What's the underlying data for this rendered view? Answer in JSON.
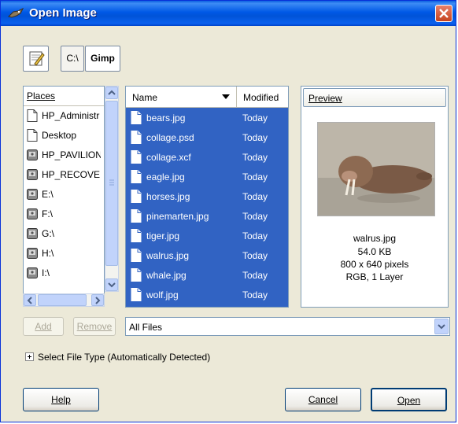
{
  "window": {
    "title": "Open Image"
  },
  "toolbar": {
    "path": [
      "C:\\",
      "Gimp"
    ]
  },
  "places": {
    "header": "Places",
    "items": [
      {
        "label": "HP_Administr",
        "icon": "document-icon"
      },
      {
        "label": "Desktop",
        "icon": "document-icon"
      },
      {
        "label": "HP_PAVILION",
        "icon": "drive-icon"
      },
      {
        "label": "HP_RECOVEI",
        "icon": "drive-icon"
      },
      {
        "label": "E:\\",
        "icon": "drive-icon"
      },
      {
        "label": "F:\\",
        "icon": "drive-icon"
      },
      {
        "label": "G:\\",
        "icon": "drive-icon"
      },
      {
        "label": "H:\\",
        "icon": "drive-icon"
      },
      {
        "label": "I:\\",
        "icon": "drive-icon"
      }
    ]
  },
  "files": {
    "columns": {
      "name": "Name",
      "modified": "Modified"
    },
    "rows": [
      {
        "name": "bears.jpg",
        "modified": "Today"
      },
      {
        "name": "collage.psd",
        "modified": "Today"
      },
      {
        "name": "collage.xcf",
        "modified": "Today"
      },
      {
        "name": "eagle.jpg",
        "modified": "Today"
      },
      {
        "name": "horses.jpg",
        "modified": "Today"
      },
      {
        "name": "pinemarten.jpg",
        "modified": "Today"
      },
      {
        "name": "tiger.jpg",
        "modified": "Today"
      },
      {
        "name": "walrus.jpg",
        "modified": "Today"
      },
      {
        "name": "whale.jpg",
        "modified": "Today"
      },
      {
        "name": "wolf.jpg",
        "modified": "Today"
      }
    ],
    "selection_color": "#3163c3"
  },
  "preview": {
    "header": "Preview",
    "filename": "walrus.jpg",
    "size": "54.0 KB",
    "dimensions": "800 x 640 pixels",
    "mode": "RGB, 1 Layer"
  },
  "bookmarks": {
    "add_label": "Add",
    "remove_label": "Remove"
  },
  "filter": {
    "selected": "All Files"
  },
  "file_type": {
    "label": "Select File Type (Automatically Detected)"
  },
  "actions": {
    "help": "Help",
    "cancel": "Cancel",
    "open": "Open"
  }
}
